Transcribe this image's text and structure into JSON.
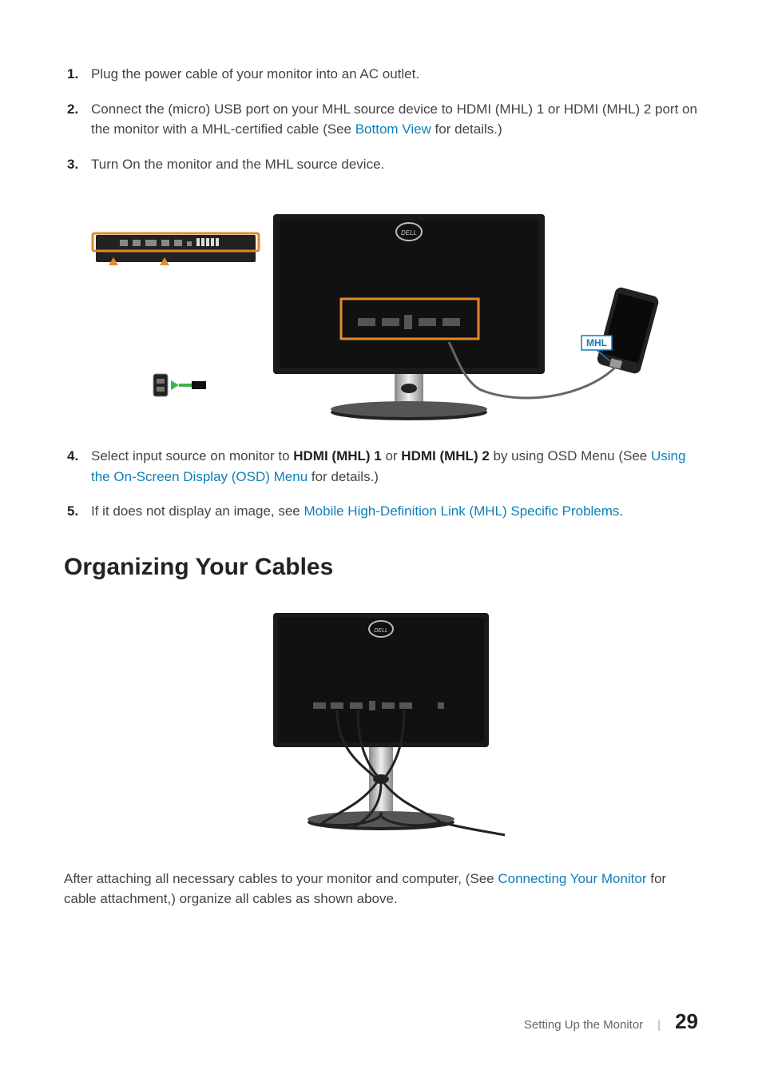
{
  "list": {
    "i1": {
      "num": "1.",
      "text": "Plug the power cable of your monitor into an AC outlet."
    },
    "i2": {
      "num": "2.",
      "text_a": "Connect the (micro) USB port on your MHL source device to HDMI (MHL) 1 or HDMI (MHL) 2 port on the monitor with a MHL-certified cable (See ",
      "link": "Bottom View",
      "text_b": " for details.)"
    },
    "i3": {
      "num": "3.",
      "text": "Turn On the monitor and the MHL source device."
    },
    "i4": {
      "num": "4.",
      "text_a": "Select input source on monitor to ",
      "b1": "HDMI (MHL) 1",
      "mid": " or ",
      "b2": "HDMI (MHL) 2",
      "text_b": " by using OSD Menu (See ",
      "link": "Using the On-Screen Display (OSD) Menu",
      "text_c": " for details.)"
    },
    "i5": {
      "num": "5.",
      "text_a": "If it does not display an image, see ",
      "link": "Mobile High-Definition Link (MHL) Specific Problems",
      "text_b": "."
    }
  },
  "heading": "Organizing Your Cables",
  "para": {
    "a": "After attaching all necessary cables to your monitor and computer, (See ",
    "link": "Connecting Your Monitor",
    "b": " for cable attachment,) organize all cables as shown above."
  },
  "footer": {
    "section": "Setting Up the Monitor",
    "page": "29"
  },
  "fig1_labels": {
    "mhl": "MHL"
  }
}
